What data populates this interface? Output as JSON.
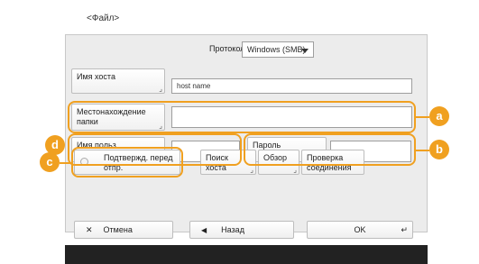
{
  "header": {
    "title": "<Файл>"
  },
  "protocol": {
    "label": "Протокол:",
    "value": "Windows (SMB)"
  },
  "host": {
    "label": "Имя хоста",
    "value": "host name"
  },
  "folder": {
    "label": "Местонахождение папки",
    "value": ""
  },
  "username": {
    "label": "Имя польз.",
    "value": ""
  },
  "password": {
    "label": "Пароль",
    "value": ""
  },
  "confirm": {
    "label": "Подтвержд. перед отпр.",
    "checked": false
  },
  "buttons": {
    "search_host": "Поиск хоста",
    "browse": "Обзор",
    "check_connection": "Проверка соединения"
  },
  "footer": {
    "cancel": "Отмена",
    "back": "Назад",
    "ok": "OK"
  },
  "callouts": {
    "a": "a",
    "b": "b",
    "c": "c",
    "d": "d"
  },
  "colors": {
    "accent": "#f0a020"
  }
}
